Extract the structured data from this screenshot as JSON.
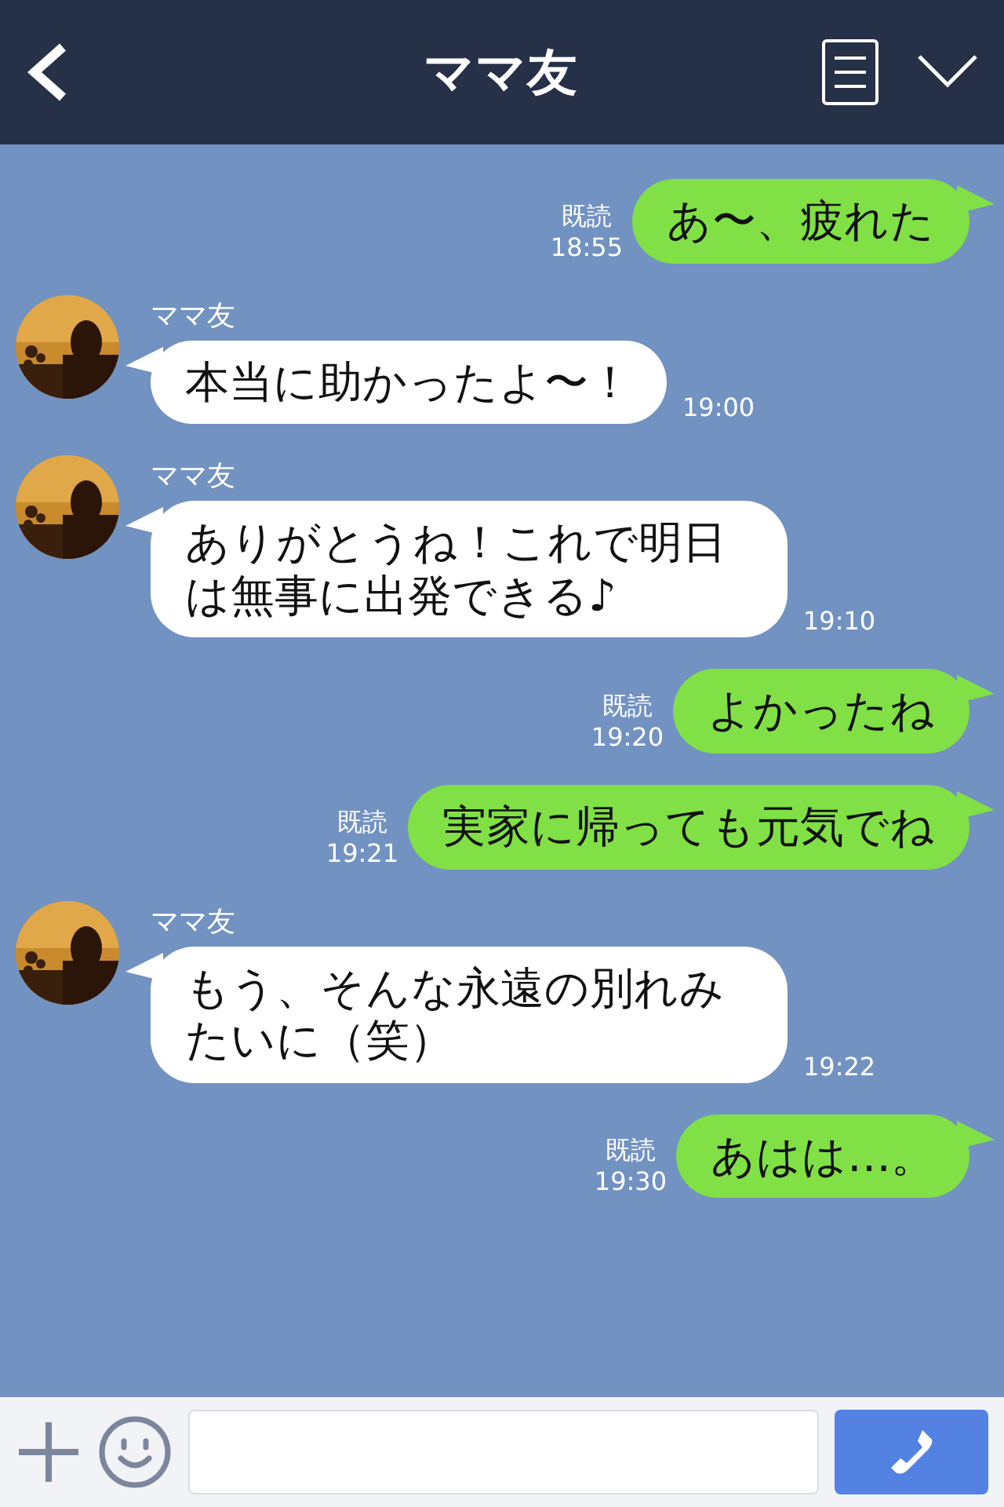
{
  "header": {
    "title": "ママ友"
  },
  "messages": [
    {
      "kind": "sent",
      "text": "あ〜、疲れた",
      "read": "既読",
      "time": "18:55"
    },
    {
      "kind": "received",
      "name": "ママ友",
      "text": "本当に助かったよ〜！",
      "time": "19:00"
    },
    {
      "kind": "received",
      "name": "ママ友",
      "text": "ありがとうね！これで明日は無事に出発できる♪",
      "time": "19:10"
    },
    {
      "kind": "sent",
      "text": "よかったね",
      "read": "既読",
      "time": "19:20"
    },
    {
      "kind": "sent",
      "text": "実家に帰っても元気でね",
      "read": "既読",
      "time": "19:21"
    },
    {
      "kind": "received",
      "name": "ママ友",
      "text": "もう、そんな永遠の別れみたいに（笑）",
      "time": "19:22"
    },
    {
      "kind": "sent",
      "text": "あはは…。",
      "read": "既読",
      "time": "19:30"
    }
  ]
}
